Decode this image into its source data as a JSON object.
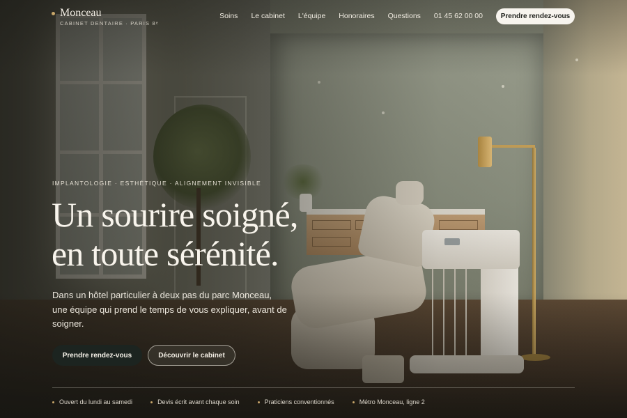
{
  "brand": {
    "name": "Monceau",
    "tagline": "CABINET DENTAIRE · PARIS 8ᵉ",
    "accent": "#c9a76a"
  },
  "nav": {
    "items": [
      {
        "label": "Soins"
      },
      {
        "label": "Le cabinet"
      },
      {
        "label": "L'équipe"
      },
      {
        "label": "Honoraires"
      },
      {
        "label": "Questions"
      },
      {
        "label": "01 45 62 00 00"
      }
    ],
    "cta_label": "Prendre rendez-vous"
  },
  "hero": {
    "eyebrow": "IMPLANTOLOGIE · ESTHÉTIQUE · ALIGNEMENT INVISIBLE",
    "headline_line1": "Un sourire soigné,",
    "headline_line2": "en toute sérénité.",
    "lede": "Dans un hôtel particulier à deux pas du parc Monceau, une équipe qui prend le temps de vous expliquer, avant de soigner.",
    "primary_cta": "Prendre rendez-vous",
    "secondary_cta": "Découvrir le cabinet"
  },
  "features": [
    {
      "label": "Ouvert du lundi au samedi"
    },
    {
      "label": "Devis écrit avant chaque soin"
    },
    {
      "label": "Praticiens conventionnés"
    },
    {
      "label": "Métro Monceau, ligne 2"
    }
  ],
  "colors": {
    "primary_button": "#1c2420",
    "cta_top_bg": "#f7f4ee",
    "text_light": "#f8f4ec"
  }
}
